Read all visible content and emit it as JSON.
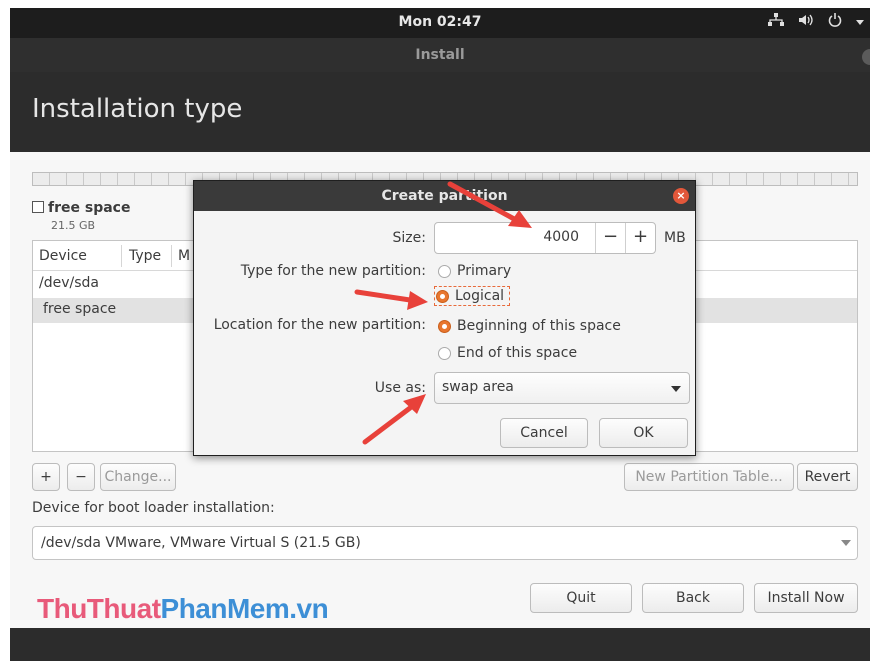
{
  "topbar": {
    "clock": "Mon 02:47",
    "network_icon": "network-icon",
    "volume_icon": "volume-icon",
    "power_icon": "power-icon"
  },
  "window": {
    "title": "Install",
    "heading": "Installation type"
  },
  "free_space": {
    "label": "free space",
    "size": "21.5 GB"
  },
  "table": {
    "columns": [
      "Device",
      "Type",
      "M"
    ],
    "rows": [
      "/dev/sda",
      "free space"
    ]
  },
  "buttons": {
    "add": "+",
    "remove": "−",
    "change": "Change...",
    "new_partition_table": "New Partition Table...",
    "revert": "Revert",
    "quit": "Quit",
    "back": "Back",
    "install_now": "Install Now"
  },
  "boot_loader": {
    "label": "Device for boot loader installation:",
    "value": "/dev/sda VMware, VMware Virtual S (21.5 GB)"
  },
  "watermark": {
    "part1": "ThuThuat",
    "part2": "PhanMem",
    "part3": ".vn"
  },
  "dialog": {
    "title": "Create partition",
    "size_label": "Size:",
    "size_value": "4000",
    "size_unit": "MB",
    "minus": "−",
    "plus": "+",
    "type_label": "Type for the new partition:",
    "type_options": [
      "Primary",
      "Logical"
    ],
    "type_selected": "Logical",
    "location_label": "Location for the new partition:",
    "location_options": [
      "Beginning of this space",
      "End of this space"
    ],
    "location_selected": "Beginning of this space",
    "use_as_label": "Use as:",
    "use_as_value": "swap area",
    "cancel": "Cancel",
    "ok": "OK"
  },
  "colors": {
    "accent": "#e8762e",
    "annotation_arrow": "#e8413a",
    "watermark_pink": "#e85a7a",
    "watermark_blue": "#3d8fd6"
  }
}
